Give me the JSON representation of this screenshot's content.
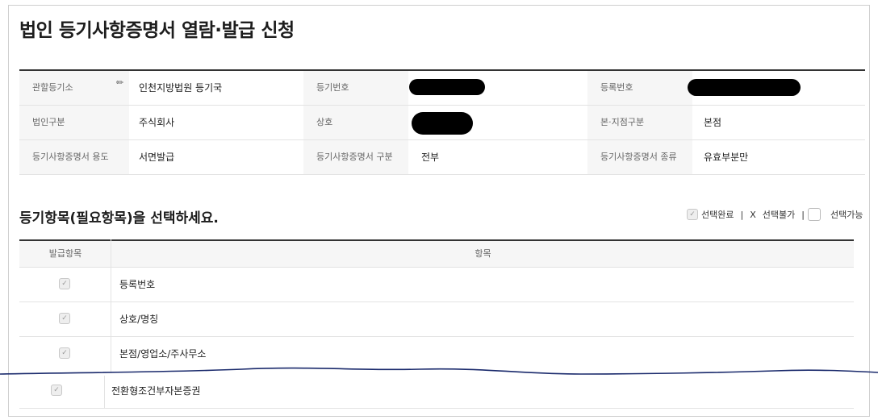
{
  "page": {
    "title": "법인 등기사항증명서 열람·발급 신청"
  },
  "info": {
    "registry_office_label": "관할등기소",
    "registry_office_value": "인천지방법원 등기국",
    "reg_number_label": "등기번호",
    "reg_number_value": "",
    "registration_number_label": "등록번호",
    "registration_number_value": "",
    "corp_type_label": "법인구분",
    "corp_type_value": "주식회사",
    "trade_name_label": "상호",
    "trade_name_value": "",
    "branch_type_label": "본·지점구분",
    "branch_type_value": "본점",
    "usage_label": "등기사항증명서 용도",
    "usage_value": "서면발급",
    "cert_type_label": "등기사항증명서 구분",
    "cert_type_value": "전부",
    "cert_kind_label": "등기사항증명서 종류",
    "cert_kind_value": "유효부분만"
  },
  "section": {
    "title": "등기항목(필요항목)을 선택하세요.",
    "legend_done": "선택완료",
    "legend_sep1": "|",
    "legend_x": "X",
    "legend_unavailable": "선택불가",
    "legend_sep2": "|",
    "legend_available": "선택가능"
  },
  "items_table": {
    "col_issue": "발급항목",
    "col_item": "항목",
    "rows": [
      {
        "name": "등록번호",
        "checked": true
      },
      {
        "name": "상호/명칭",
        "checked": true
      },
      {
        "name": "본점/영업소/주사무소",
        "checked": true
      }
    ],
    "bottom_row": {
      "name": "전환형조건부자본증권",
      "checked": true
    }
  },
  "icons": {
    "pencil": "pencil-icon",
    "check": "check-icon"
  },
  "colors": {
    "header_bg": "#f6f6f6",
    "border": "#e3e3e3",
    "rule": "#333333",
    "redaction": "#000000"
  }
}
